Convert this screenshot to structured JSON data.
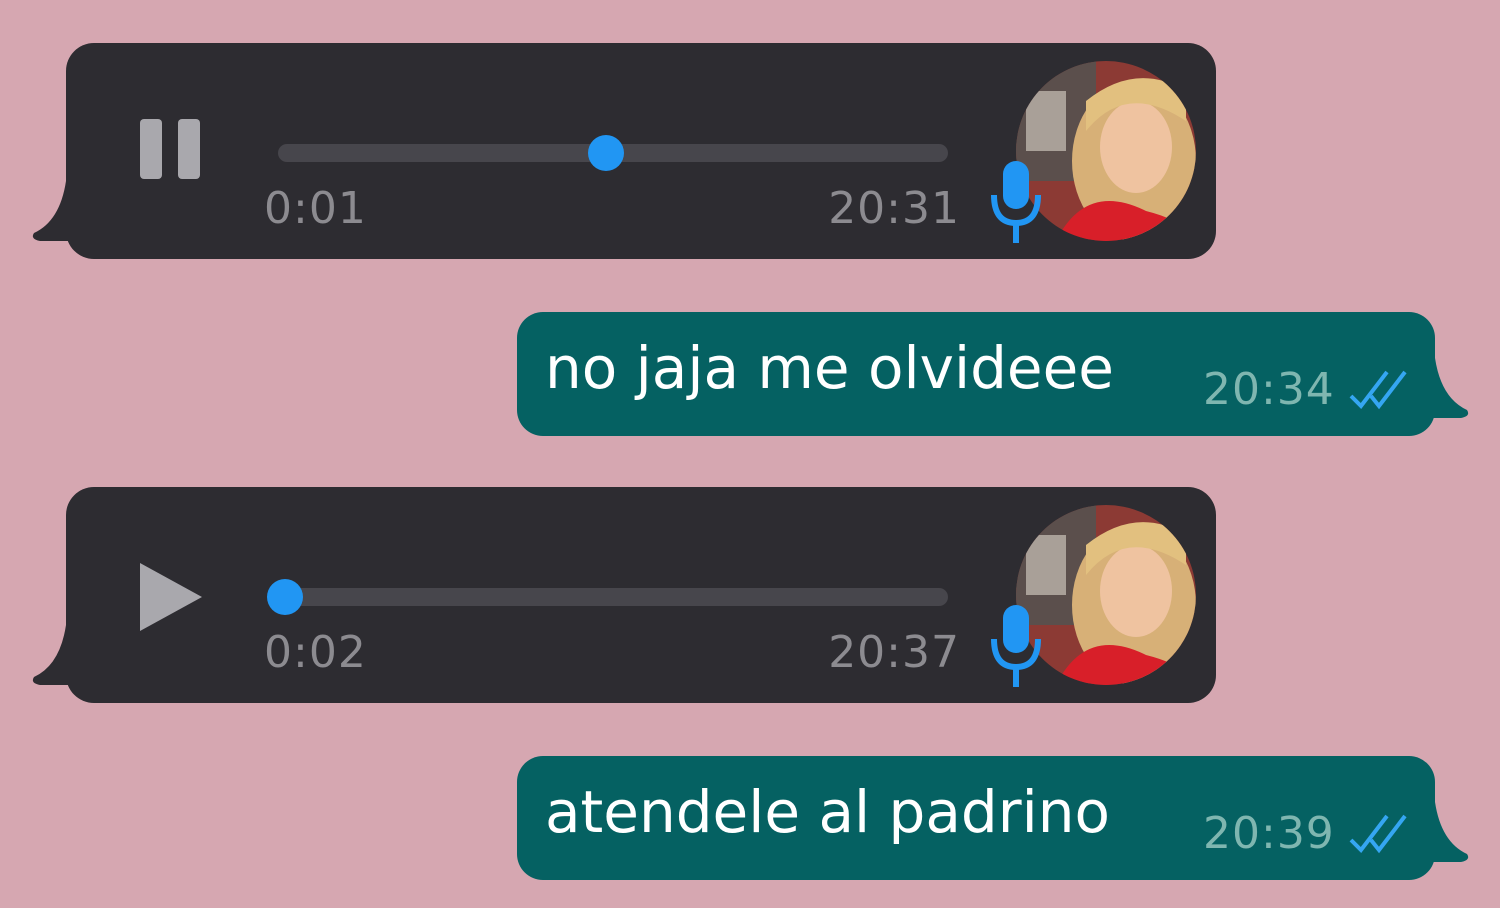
{
  "colors": {
    "background": "#d6a7b1",
    "incoming_bubble": "#2d2c31",
    "outgoing_bubble": "#056162",
    "accent_blue": "#2196f3",
    "read_ticks": "#35a6f2"
  },
  "messages": [
    {
      "type": "voice",
      "state": "playing",
      "control_icon": "pause-icon",
      "duration": "0:01",
      "time": "20:31",
      "progress": 0.49
    },
    {
      "type": "text",
      "text": "no jaja me olvideee",
      "time": "20:34",
      "status_icon": "double-check-icon"
    },
    {
      "type": "voice",
      "state": "paused",
      "control_icon": "play-icon",
      "duration": "0:02",
      "time": "20:37",
      "progress": 0.01
    },
    {
      "type": "text",
      "text": "atendele al padrino",
      "time": "20:39",
      "status_icon": "double-check-icon"
    }
  ]
}
